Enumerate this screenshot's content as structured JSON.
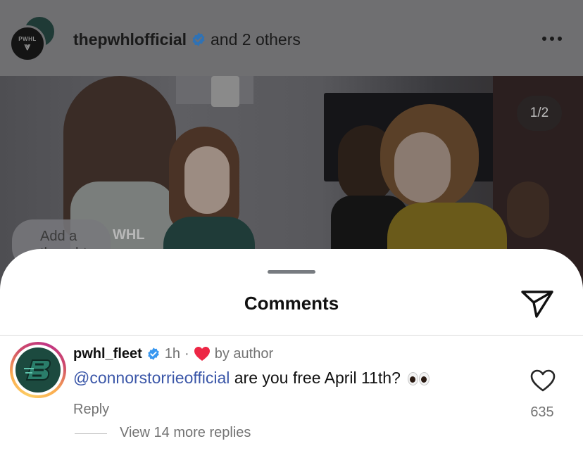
{
  "post": {
    "author": "thepwhlofficial",
    "collaborators": "and 2 others",
    "avatar_text": "PWHL",
    "image_counter": "1/2",
    "thought_placeholder": "Add a thought",
    "photo_overlay_text": "WHL"
  },
  "icons": {
    "more": "more-options-icon",
    "verified": "verified-badge-icon",
    "send": "send-icon",
    "like": "heart-outline-icon",
    "author_like": "heart-filled-icon",
    "comment_emoji": "eyes-emoji"
  },
  "colors": {
    "verified": "#3897f0",
    "mention": "#3a56a8",
    "heart": "#ed2645",
    "fleet_green": "#1c4a3f"
  },
  "comments_sheet": {
    "title": "Comments",
    "comments": [
      {
        "username": "pwhl_fleet",
        "time": "1h",
        "separator": "·",
        "author_like_label": "by author",
        "mention": "@connorstorrieofficial",
        "text": "are you free April 11th?",
        "reply_label": "Reply",
        "like_count": "635",
        "view_replies_label": "View 14 more replies"
      }
    ]
  }
}
